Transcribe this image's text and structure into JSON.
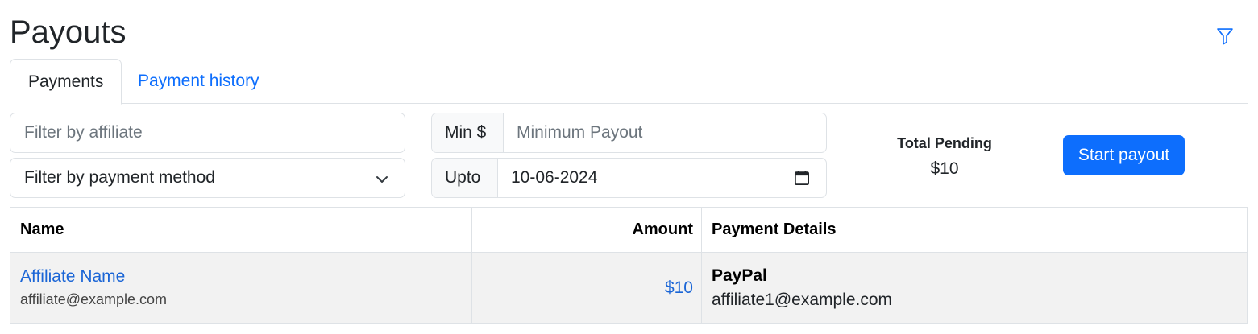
{
  "page": {
    "title": "Payouts"
  },
  "icons": {
    "filter": "filter-icon",
    "chevron": "chevron-down-icon",
    "calendar": "calendar-icon"
  },
  "colors": {
    "accent": "#0d6efd",
    "link": "#1a65d6",
    "row_bg": "#f2f2f2",
    "border": "#dee2e6"
  },
  "tabs": [
    {
      "label": "Payments",
      "active": true
    },
    {
      "label": "Payment history",
      "active": false
    }
  ],
  "filters": {
    "affiliate_placeholder": "Filter by affiliate",
    "payment_method_value": "Filter by payment method",
    "min_addon": "Min $",
    "min_placeholder": "Minimum Payout",
    "upto_addon": "Upto",
    "upto_value": "10-06-2024"
  },
  "summary": {
    "total_pending_label": "Total Pending",
    "total_pending_value": "$10",
    "start_button": "Start payout"
  },
  "table": {
    "headers": {
      "name": "Name",
      "amount": "Amount",
      "details": "Payment Details"
    },
    "rows": [
      {
        "affiliate_name": "Affiliate Name",
        "affiliate_email": "affiliate@example.com",
        "amount": "$10",
        "method": "PayPal",
        "method_email": "affiliate1@example.com"
      }
    ]
  }
}
